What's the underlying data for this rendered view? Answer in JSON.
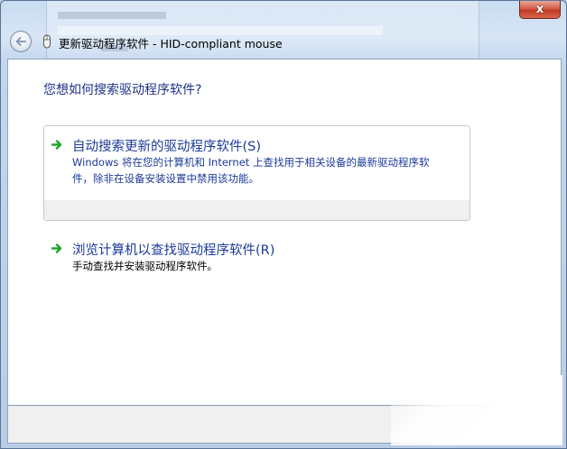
{
  "window": {
    "title": "更新驱动程序软件 - HID-compliant mouse",
    "close_symbol": "x"
  },
  "icons": {
    "back": "back-arrow-icon",
    "device": "mouse-device-icon",
    "close": "close-icon",
    "option_arrow": "green-arrow-icon"
  },
  "main": {
    "question": "您想如何搜索驱动程序软件?",
    "options": [
      {
        "title": "自动搜索更新的驱动程序软件(S)",
        "description_line1": "Windows 将在您的计算机和 Internet 上查找用于相关设备的最新驱动程序软",
        "description_line2": "件，除非在设备安装设置中禁用该功能。"
      },
      {
        "title": "浏览计算机以查找驱动程序软件(R)",
        "description_line1": "手动查找并安装驱动程序软件。"
      }
    ]
  },
  "colors": {
    "link_blue": "#1c3a99",
    "heading_blue": "#1e3287",
    "arrow_green": "#1fa62d",
    "close_red": "#c23a22"
  }
}
